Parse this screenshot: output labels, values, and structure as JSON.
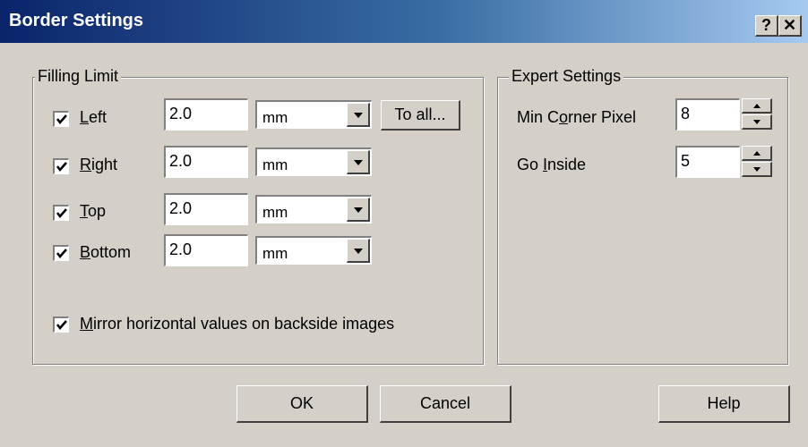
{
  "window": {
    "title": "Border Settings",
    "help_label": "?",
    "close_label": "✕"
  },
  "filling_limit": {
    "legend": "Filling Limit",
    "rows": [
      {
        "label": "Left",
        "mnemonic": "L",
        "rest": "eft",
        "checked": true,
        "value": "2.0",
        "unit": "mm"
      },
      {
        "label": "Right",
        "mnemonic": "R",
        "rest": "ight",
        "checked": true,
        "value": "2.0",
        "unit": "mm"
      },
      {
        "label": "Top",
        "mnemonic": "T",
        "rest": "op",
        "checked": true,
        "value": "2.0",
        "unit": "mm"
      },
      {
        "label": "Bottom",
        "mnemonic": "B",
        "rest": "ottom",
        "checked": true,
        "value": "2.0",
        "unit": "mm"
      }
    ],
    "to_all_label": "To all...",
    "mirror": {
      "checked": true,
      "mnemonic": "M",
      "rest": "irror horizontal values on backside images"
    }
  },
  "expert_settings": {
    "legend": "Expert Settings",
    "min_corner": {
      "pre": "Min C",
      "mnemonic": "o",
      "post": "rner Pixel",
      "value": "8"
    },
    "go_inside": {
      "pre": "Go ",
      "mnemonic": "I",
      "post": "nside",
      "value": "5"
    }
  },
  "buttons": {
    "ok": "OK",
    "cancel": "Cancel",
    "help": "Help"
  }
}
